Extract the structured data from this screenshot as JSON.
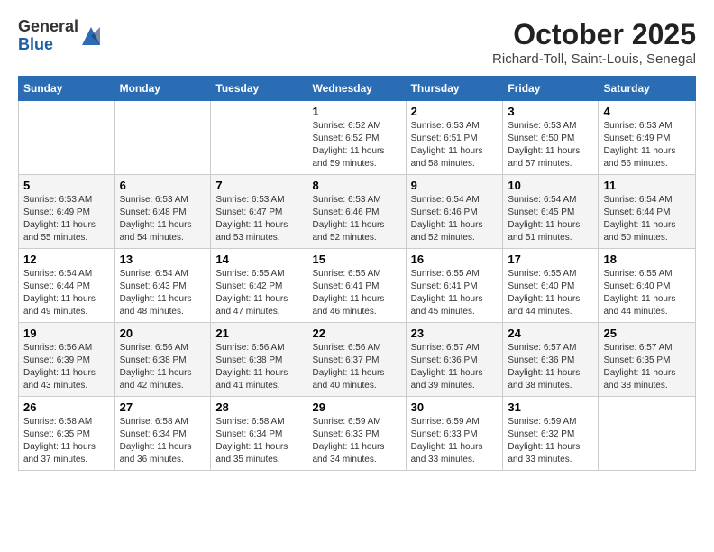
{
  "header": {
    "logo_general": "General",
    "logo_blue": "Blue",
    "month_year": "October 2025",
    "location": "Richard-Toll, Saint-Louis, Senegal"
  },
  "weekdays": [
    "Sunday",
    "Monday",
    "Tuesday",
    "Wednesday",
    "Thursday",
    "Friday",
    "Saturday"
  ],
  "weeks": [
    [
      {
        "day": "",
        "sunrise": "",
        "sunset": "",
        "daylight": ""
      },
      {
        "day": "",
        "sunrise": "",
        "sunset": "",
        "daylight": ""
      },
      {
        "day": "",
        "sunrise": "",
        "sunset": "",
        "daylight": ""
      },
      {
        "day": "1",
        "sunrise": "Sunrise: 6:52 AM",
        "sunset": "Sunset: 6:52 PM",
        "daylight": "Daylight: 11 hours and 59 minutes."
      },
      {
        "day": "2",
        "sunrise": "Sunrise: 6:53 AM",
        "sunset": "Sunset: 6:51 PM",
        "daylight": "Daylight: 11 hours and 58 minutes."
      },
      {
        "day": "3",
        "sunrise": "Sunrise: 6:53 AM",
        "sunset": "Sunset: 6:50 PM",
        "daylight": "Daylight: 11 hours and 57 minutes."
      },
      {
        "day": "4",
        "sunrise": "Sunrise: 6:53 AM",
        "sunset": "Sunset: 6:49 PM",
        "daylight": "Daylight: 11 hours and 56 minutes."
      }
    ],
    [
      {
        "day": "5",
        "sunrise": "Sunrise: 6:53 AM",
        "sunset": "Sunset: 6:49 PM",
        "daylight": "Daylight: 11 hours and 55 minutes."
      },
      {
        "day": "6",
        "sunrise": "Sunrise: 6:53 AM",
        "sunset": "Sunset: 6:48 PM",
        "daylight": "Daylight: 11 hours and 54 minutes."
      },
      {
        "day": "7",
        "sunrise": "Sunrise: 6:53 AM",
        "sunset": "Sunset: 6:47 PM",
        "daylight": "Daylight: 11 hours and 53 minutes."
      },
      {
        "day": "8",
        "sunrise": "Sunrise: 6:53 AM",
        "sunset": "Sunset: 6:46 PM",
        "daylight": "Daylight: 11 hours and 52 minutes."
      },
      {
        "day": "9",
        "sunrise": "Sunrise: 6:54 AM",
        "sunset": "Sunset: 6:46 PM",
        "daylight": "Daylight: 11 hours and 52 minutes."
      },
      {
        "day": "10",
        "sunrise": "Sunrise: 6:54 AM",
        "sunset": "Sunset: 6:45 PM",
        "daylight": "Daylight: 11 hours and 51 minutes."
      },
      {
        "day": "11",
        "sunrise": "Sunrise: 6:54 AM",
        "sunset": "Sunset: 6:44 PM",
        "daylight": "Daylight: 11 hours and 50 minutes."
      }
    ],
    [
      {
        "day": "12",
        "sunrise": "Sunrise: 6:54 AM",
        "sunset": "Sunset: 6:44 PM",
        "daylight": "Daylight: 11 hours and 49 minutes."
      },
      {
        "day": "13",
        "sunrise": "Sunrise: 6:54 AM",
        "sunset": "Sunset: 6:43 PM",
        "daylight": "Daylight: 11 hours and 48 minutes."
      },
      {
        "day": "14",
        "sunrise": "Sunrise: 6:55 AM",
        "sunset": "Sunset: 6:42 PM",
        "daylight": "Daylight: 11 hours and 47 minutes."
      },
      {
        "day": "15",
        "sunrise": "Sunrise: 6:55 AM",
        "sunset": "Sunset: 6:41 PM",
        "daylight": "Daylight: 11 hours and 46 minutes."
      },
      {
        "day": "16",
        "sunrise": "Sunrise: 6:55 AM",
        "sunset": "Sunset: 6:41 PM",
        "daylight": "Daylight: 11 hours and 45 minutes."
      },
      {
        "day": "17",
        "sunrise": "Sunrise: 6:55 AM",
        "sunset": "Sunset: 6:40 PM",
        "daylight": "Daylight: 11 hours and 44 minutes."
      },
      {
        "day": "18",
        "sunrise": "Sunrise: 6:55 AM",
        "sunset": "Sunset: 6:40 PM",
        "daylight": "Daylight: 11 hours and 44 minutes."
      }
    ],
    [
      {
        "day": "19",
        "sunrise": "Sunrise: 6:56 AM",
        "sunset": "Sunset: 6:39 PM",
        "daylight": "Daylight: 11 hours and 43 minutes."
      },
      {
        "day": "20",
        "sunrise": "Sunrise: 6:56 AM",
        "sunset": "Sunset: 6:38 PM",
        "daylight": "Daylight: 11 hours and 42 minutes."
      },
      {
        "day": "21",
        "sunrise": "Sunrise: 6:56 AM",
        "sunset": "Sunset: 6:38 PM",
        "daylight": "Daylight: 11 hours and 41 minutes."
      },
      {
        "day": "22",
        "sunrise": "Sunrise: 6:56 AM",
        "sunset": "Sunset: 6:37 PM",
        "daylight": "Daylight: 11 hours and 40 minutes."
      },
      {
        "day": "23",
        "sunrise": "Sunrise: 6:57 AM",
        "sunset": "Sunset: 6:36 PM",
        "daylight": "Daylight: 11 hours and 39 minutes."
      },
      {
        "day": "24",
        "sunrise": "Sunrise: 6:57 AM",
        "sunset": "Sunset: 6:36 PM",
        "daylight": "Daylight: 11 hours and 38 minutes."
      },
      {
        "day": "25",
        "sunrise": "Sunrise: 6:57 AM",
        "sunset": "Sunset: 6:35 PM",
        "daylight": "Daylight: 11 hours and 38 minutes."
      }
    ],
    [
      {
        "day": "26",
        "sunrise": "Sunrise: 6:58 AM",
        "sunset": "Sunset: 6:35 PM",
        "daylight": "Daylight: 11 hours and 37 minutes."
      },
      {
        "day": "27",
        "sunrise": "Sunrise: 6:58 AM",
        "sunset": "Sunset: 6:34 PM",
        "daylight": "Daylight: 11 hours and 36 minutes."
      },
      {
        "day": "28",
        "sunrise": "Sunrise: 6:58 AM",
        "sunset": "Sunset: 6:34 PM",
        "daylight": "Daylight: 11 hours and 35 minutes."
      },
      {
        "day": "29",
        "sunrise": "Sunrise: 6:59 AM",
        "sunset": "Sunset: 6:33 PM",
        "daylight": "Daylight: 11 hours and 34 minutes."
      },
      {
        "day": "30",
        "sunrise": "Sunrise: 6:59 AM",
        "sunset": "Sunset: 6:33 PM",
        "daylight": "Daylight: 11 hours and 33 minutes."
      },
      {
        "day": "31",
        "sunrise": "Sunrise: 6:59 AM",
        "sunset": "Sunset: 6:32 PM",
        "daylight": "Daylight: 11 hours and 33 minutes."
      },
      {
        "day": "",
        "sunrise": "",
        "sunset": "",
        "daylight": ""
      }
    ]
  ]
}
